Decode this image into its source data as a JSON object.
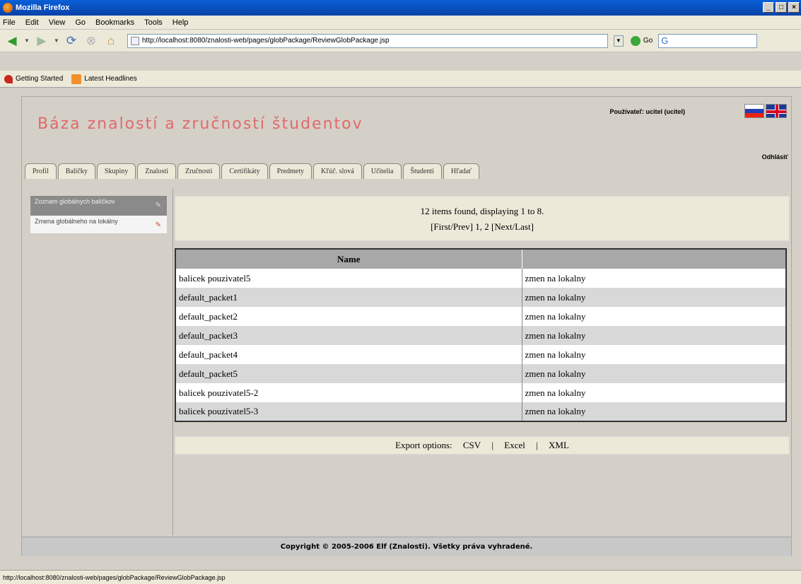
{
  "window": {
    "title": "Mozilla Firefox"
  },
  "menu": [
    "File",
    "Edit",
    "View",
    "Go",
    "Bookmarks",
    "Tools",
    "Help"
  ],
  "nav": {
    "url": "http://localhost:8080/znalosti-web/pages/globPackage/ReviewGlobPackage.jsp",
    "go_label": "Go"
  },
  "bookmarks": [
    {
      "label": "Getting Started"
    },
    {
      "label": "Latest Headlines"
    }
  ],
  "site": {
    "title": "Báza znalostí a zručností študentov",
    "user": "Používateľ: ucitel (ucitel)",
    "logout": "Odhlásiť"
  },
  "tabs": [
    "Profil",
    "Balíčky",
    "Skupiny",
    "Znalosti",
    "Zručnosti",
    "Certifikáty",
    "Predmety",
    "Kľúč. slová",
    "Učitelia",
    "Študenti",
    "Hľadať"
  ],
  "left_menu": [
    {
      "label": "Zoznam globálnych balíčkov"
    },
    {
      "label": "Zmena globálneho na lokálny"
    }
  ],
  "paging": {
    "summary": "12 items found, displaying 1 to 8.",
    "links": "[First/Prev] 1, 2 [Next/Last]"
  },
  "table": {
    "headers": [
      "Name",
      ""
    ],
    "rows": [
      {
        "name": "balicek pouzivatel5",
        "action": "zmen na lokalny"
      },
      {
        "name": "default_packet1",
        "action": "zmen na lokalny"
      },
      {
        "name": "default_packet2",
        "action": "zmen na lokalny"
      },
      {
        "name": "default_packet3",
        "action": "zmen na lokalny"
      },
      {
        "name": "default_packet4",
        "action": "zmen na lokalny"
      },
      {
        "name": "default_packet5",
        "action": "zmen na lokalny"
      },
      {
        "name": "balicek pouzivatel5-2",
        "action": "zmen na lokalny"
      },
      {
        "name": "balicek pouzivatel5-3",
        "action": "zmen na lokalny"
      }
    ]
  },
  "export": {
    "label": "Export options:",
    "csv": "CSV",
    "excel": "Excel",
    "xml": "XML",
    "sep": "|"
  },
  "footer": "Copyright © 2005-2006 Elf (Znalosti). Všetky práva vyhradené.",
  "status": "http://localhost:8080/znalosti-web/pages/globPackage/ReviewGlobPackage.jsp"
}
